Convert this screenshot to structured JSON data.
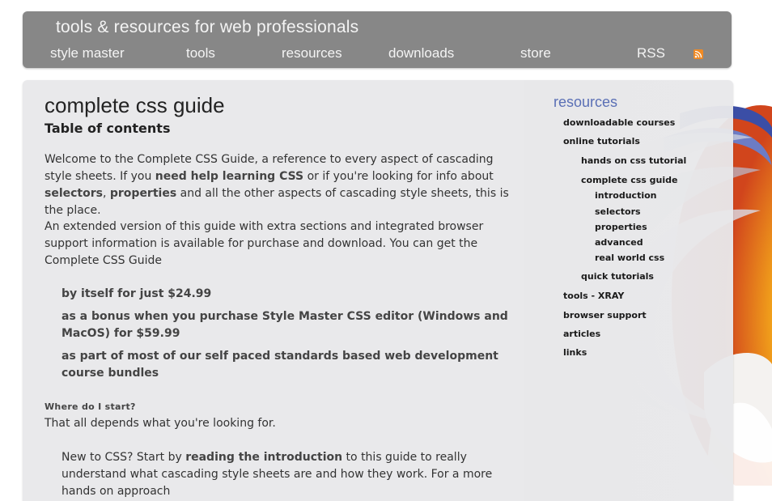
{
  "header": {
    "tagline": "tools & resources for web professionals",
    "nav": [
      {
        "label": "style master"
      },
      {
        "label": "tools"
      },
      {
        "label": "resources"
      },
      {
        "label": "downloads"
      },
      {
        "label": "store"
      },
      {
        "label": "RSS"
      }
    ],
    "rss_icon": "rss-feed-icon"
  },
  "main": {
    "title": "complete css guide",
    "subtitle": "Table of contents",
    "intro": {
      "p1_a": "Welcome to the Complete CSS Guide, a reference to every aspect of cascading style sheets. If you ",
      "p1_link1": "need help learning CSS",
      "p1_b": " or if you're looking for info about ",
      "p1_link2": "selectors",
      "p1_c": ", ",
      "p1_link3": "properties",
      "p1_d": " and all the other aspects of cascading style sheets, this is the place.",
      "p2": "An extended version of this guide with extra sections and integrated browser support information is available for purchase and download. You can get the Complete CSS Guide"
    },
    "offers": [
      "by itself for just $24.99",
      "as a bonus when you purchase Style Master CSS editor (Windows and MacOS) for $59.99",
      "as part of most of our self paced standards based web development course bundles"
    ],
    "where_heading": "Where do I start?",
    "where_text": "That all depends what you're looking for.",
    "new_a": "New to CSS? Start by ",
    "new_link": "reading the introduction",
    "new_b": " to this guide to really understand what cascading style sheets are and how they work. For a more hands on approach"
  },
  "sidebar": {
    "title": "resources",
    "items": [
      {
        "label": "downloadable courses"
      },
      {
        "label": "online tutorials"
      },
      {
        "label": "hands on css tutorial"
      },
      {
        "label": "complete css guide"
      },
      {
        "label": "introduction"
      },
      {
        "label": "selectors"
      },
      {
        "label": "properties"
      },
      {
        "label": "advanced"
      },
      {
        "label": "real world css"
      },
      {
        "label": "quick tutorials"
      },
      {
        "label": "tools - XRAY"
      },
      {
        "label": "browser support"
      },
      {
        "label": "articles"
      },
      {
        "label": "links"
      }
    ]
  },
  "colors": {
    "header_bg": "#878787",
    "panel_bg": "#e8e8ea",
    "sidebar_title": "#5a6fb5",
    "rss": "#f08a24"
  }
}
